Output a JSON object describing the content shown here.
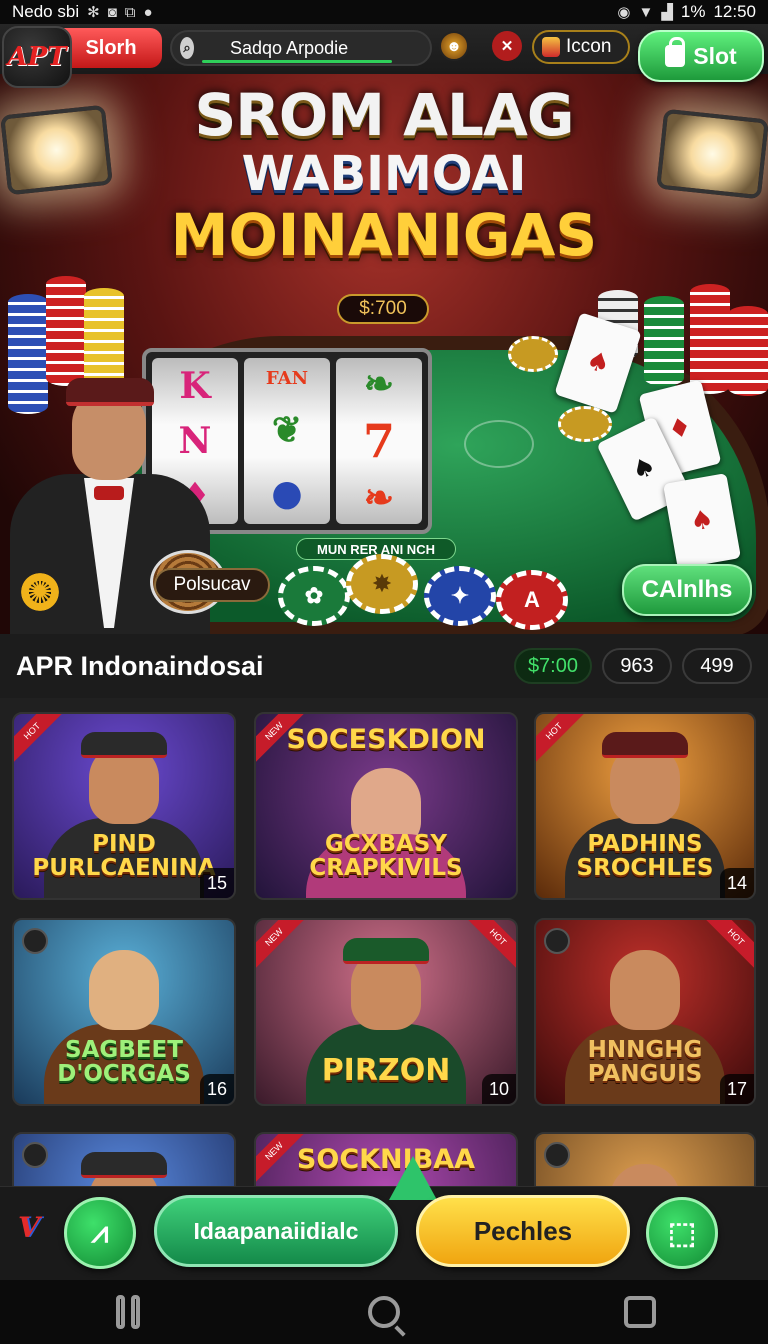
{
  "status_bar": {
    "left_text": "Nedo sbi",
    "left_icons": [
      "bluetooth-icon",
      "camera-icon",
      "screenshot-icon",
      "dot-icon"
    ],
    "right_icons": [
      "alarm-icon",
      "wifi-icon",
      "signal-icon"
    ],
    "battery": "1%",
    "time": "12:50"
  },
  "app_bar": {
    "logo_text": "APT",
    "slot_tab_label": "Slorh",
    "search_value": "Sadqo Arpodie",
    "icon_chip_label": "Iccon",
    "slot_button_label": "Slot"
  },
  "hero": {
    "title_line1": "SROM ALAG",
    "title_line2": "WABIMOAI",
    "title_line3": "MOINANIGAS",
    "jackpot": "$:700",
    "reel_symbols": [
      [
        "K",
        "N",
        "♦"
      ],
      [
        "FAN",
        "❦",
        "●"
      ],
      [
        "❧",
        "7",
        "❧"
      ]
    ],
    "machine_label": "MUN RER ANI NCH",
    "pill_label": "Polsucav",
    "cta_label": "CAlnlhs",
    "colors": {
      "felt": "#1f8a45",
      "cta": "#2fb052",
      "title_gold": "#ffcf3a"
    }
  },
  "section": {
    "title": "APR Indonaindosai",
    "pills": [
      "$7:00",
      "963",
      "499"
    ]
  },
  "games": [
    {
      "name": "PIND PURLCAENINA",
      "count": "15",
      "bg": "#3c2a6e"
    },
    {
      "name": "GCXBASY CRAPKIVILS",
      "top": "SOCESKDION",
      "count": "",
      "bg": "#3a2850"
    },
    {
      "name": "PADHINS SROCHLES",
      "count": "14",
      "bg": "#7a4a1a"
    },
    {
      "name": "SAGBEET D'OCRGAS",
      "count": "16",
      "bg": "#255a7a"
    },
    {
      "name": "PIRZON",
      "count": "10",
      "bg": "#5a2a3a"
    },
    {
      "name": "HNNGHG PANGUIS",
      "count": "17",
      "bg": "#7a1a1a"
    },
    {
      "name": "",
      "count": "",
      "bg": "#2a4a8a"
    },
    {
      "name": "",
      "top": "SOCKNIBAA",
      "count": "",
      "bg": "#5a2a6a"
    },
    {
      "name": "",
      "count": "",
      "bg": "#8a5a2a"
    }
  ],
  "action_bar": {
    "logo": "V",
    "green_pill_label": "Idaapanaiidialc",
    "yellow_pill_label": "Pechles"
  }
}
